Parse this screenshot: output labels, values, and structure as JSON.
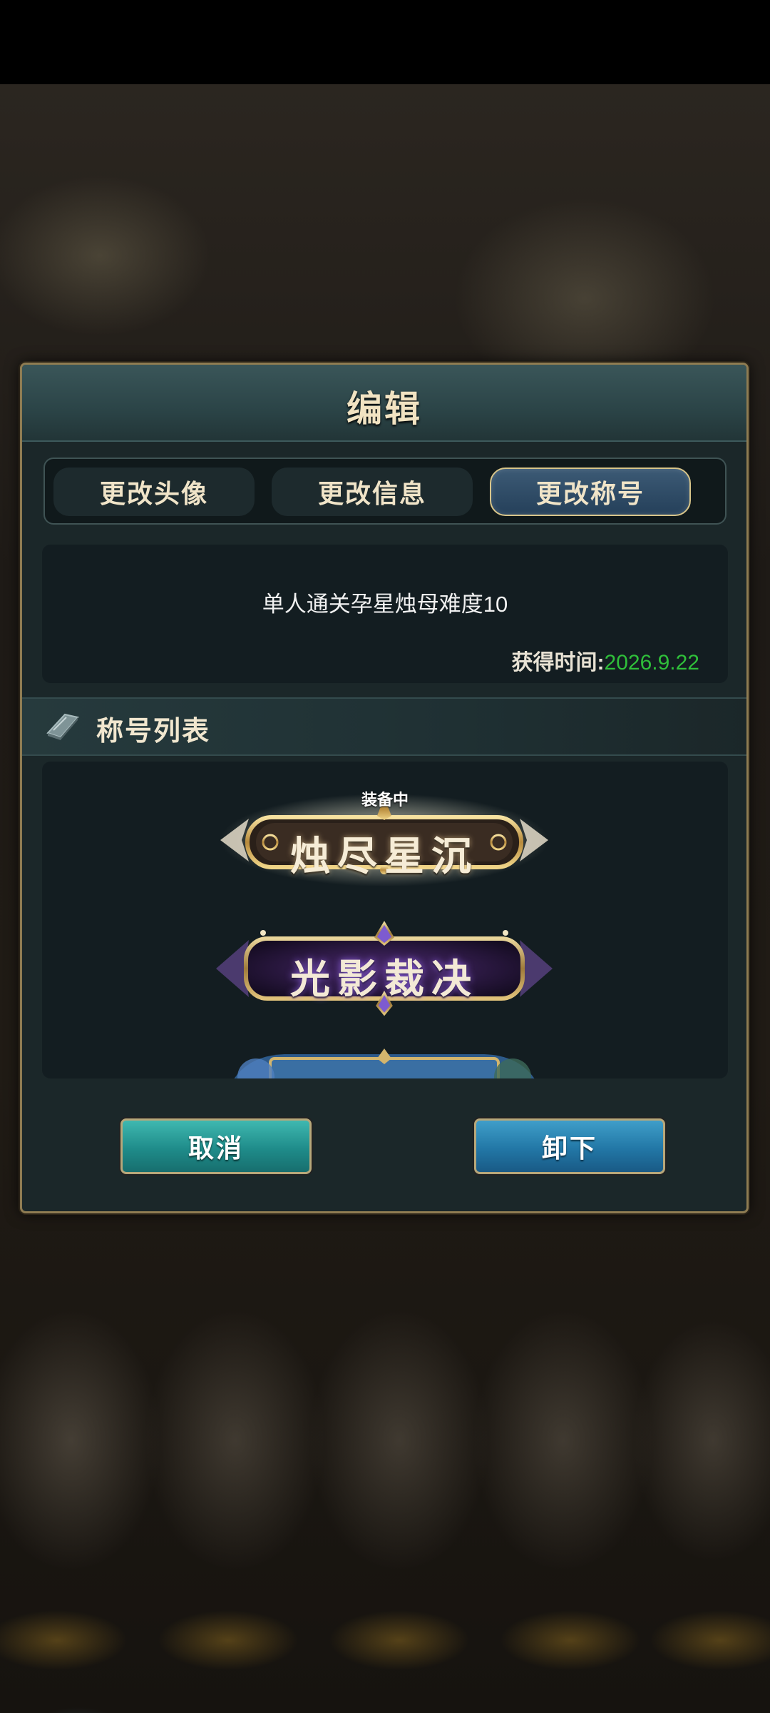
{
  "dialog": {
    "title": "编辑",
    "tabs": [
      {
        "label": "更改头像",
        "active": false
      },
      {
        "label": "更改信息",
        "active": false
      },
      {
        "label": "更改称号",
        "active": true
      }
    ],
    "selected_title": {
      "condition": "单人通关孕星烛母难度10",
      "obtained_label": "获得时间:",
      "obtained_date": "2026.9.22"
    },
    "list": {
      "header": "称号列表",
      "equipped_label": "装备中",
      "items": [
        {
          "name": "烛尽星沉",
          "equipped": true,
          "theme": "gold"
        },
        {
          "name": "光影裁决",
          "equipped": false,
          "theme": "purple"
        },
        {
          "name": "",
          "equipped": false,
          "theme": "blue"
        }
      ]
    },
    "buttons": {
      "cancel": "取消",
      "remove": "卸下"
    }
  },
  "colors": {
    "date_green": "#2fbf3a",
    "frame_gold": "#8f7c52",
    "cancel_teal": "#1f8c8a",
    "remove_blue": "#2277a6"
  }
}
